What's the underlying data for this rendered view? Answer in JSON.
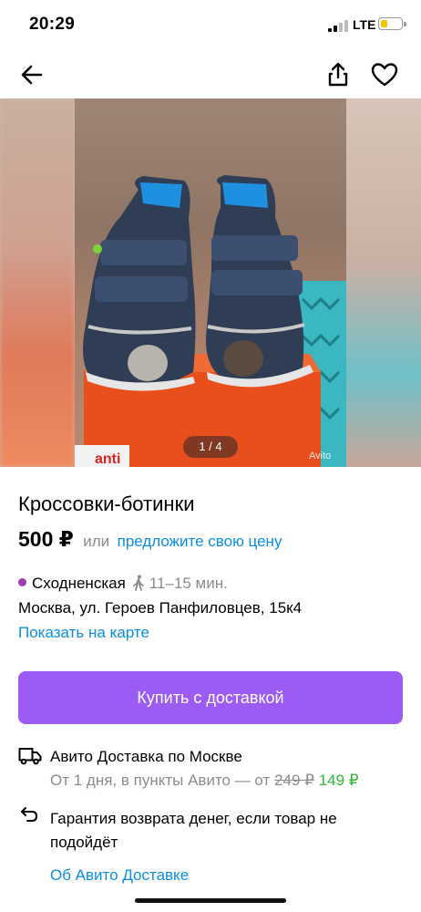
{
  "status_bar": {
    "time": "20:29",
    "network": "LTE",
    "battery_level": 0.3,
    "battery_color": "#f5c400"
  },
  "nav": {
    "back_icon": "arrow-left-icon",
    "share_icon": "share-icon",
    "favorite_icon": "heart-icon"
  },
  "gallery": {
    "counter": "1 / 4",
    "watermark": "Avito"
  },
  "listing": {
    "title": "Кроссовки-ботинки",
    "price": "500 ₽",
    "price_or": "или",
    "offer_link": "предложите свою цену",
    "metro_station": "Сходненская",
    "metro_color": "#9c3fb0",
    "walk_time": "11–15 мин.",
    "address": "Москва, ул. Героев Панфиловцев, 15к4",
    "map_link": "Показать на карте"
  },
  "actions": {
    "buy_button": "Купить с доставкой",
    "buy_button_color": "#9c5cf4"
  },
  "delivery": {
    "icon": "truck-icon",
    "title": "Авито Доставка по Москве",
    "subtitle_prefix": "От 1 дня, в пункты Авито — от",
    "old_price": "249 ₽",
    "new_price": "149 ₽",
    "new_price_color": "#2cb934"
  },
  "guarantee": {
    "icon": "return-arrow-icon",
    "text": "Гарантия возврата денег, если товар не подойдёт"
  },
  "about_link": "Об Авито Доставке",
  "accent_color": "#0a8ee6"
}
